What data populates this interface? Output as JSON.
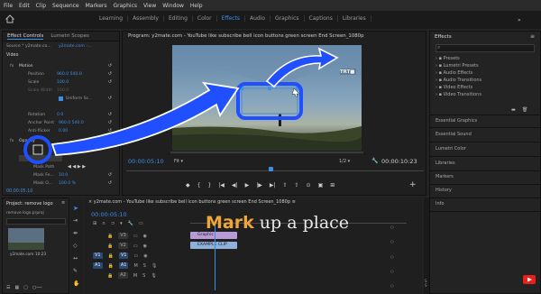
{
  "menu": [
    "File",
    "Edit",
    "Clip",
    "Sequence",
    "Markers",
    "Graphics",
    "View",
    "Window",
    "Help"
  ],
  "workspaces": {
    "tabs": [
      "Learning",
      "Assembly",
      "Editing",
      "Color",
      "Effects",
      "Audio",
      "Graphics",
      "Captions",
      "Libraries"
    ],
    "active": "Effects"
  },
  "effect_controls": {
    "tabs": [
      "Effect Controls",
      "Lumetri Scopes"
    ],
    "source": "Source * y2mate.co...",
    "sequence": "y2mate.com -...",
    "section": "Video",
    "rows": [
      {
        "label": "Motion",
        "value": ""
      },
      {
        "label": "Position",
        "value": "960.0    540.0"
      },
      {
        "label": "Scale",
        "value": "100.0"
      },
      {
        "label": "Scale Width",
        "value": "100.0"
      },
      {
        "label": "",
        "value": "Uniform Sc..."
      },
      {
        "label": "Rotation",
        "value": "0.0"
      },
      {
        "label": "Anchor Point",
        "value": "960.0    540.0"
      },
      {
        "label": "Anti-flicker",
        "value": "0.00"
      },
      {
        "label": "Opacity",
        "value": ""
      },
      {
        "label": "Mask Path",
        "value": ""
      },
      {
        "label": "Mask Fe...",
        "value": "10.0"
      },
      {
        "label": "Mask O...",
        "value": "100.0 %"
      }
    ],
    "timecode": "00:00:05:10"
  },
  "program_monitor": {
    "title": "Program: y2mate.com - YouTube like subscribe bell icon buttons green screen End Screen_1080p",
    "timecode": "00:00:05:10",
    "fit": "Fit",
    "resolution": "1/2",
    "duration": "00:00:10:23",
    "watermark": "TRT■"
  },
  "effects_panel": {
    "title": "Effects",
    "items": [
      "Presets",
      "Lumetri Presets",
      "Audio Effects",
      "Audio Transitions",
      "Video Effects",
      "Video Transitions"
    ],
    "sections": [
      "Essential Graphics",
      "Essential Sound",
      "Lumetri Color",
      "Libraries",
      "Markers",
      "History",
      "Info"
    ]
  },
  "project": {
    "title": "Project: remove logo",
    "file": "remove logo.prproj",
    "thumb_label": "y2mate.com",
    "thumb_duration": "10:23"
  },
  "timeline": {
    "title": "y2mate.com - YouTube like subscribe bell icon buttons green screen End Screen_1080p",
    "timecode": "00:00:05:10",
    "tracks": [
      "V3",
      "V2",
      "V1",
      "A1",
      "A2"
    ],
    "clips": [
      "Graphic",
      "EXAMPLE CLIP"
    ]
  },
  "overlay_text": {
    "highlight": "Mark",
    "rest": " up a place"
  },
  "colors": {
    "accent": "#3e8ee6",
    "annotation": "#1f4fff",
    "overlay_highlight": "#f0a53a"
  }
}
